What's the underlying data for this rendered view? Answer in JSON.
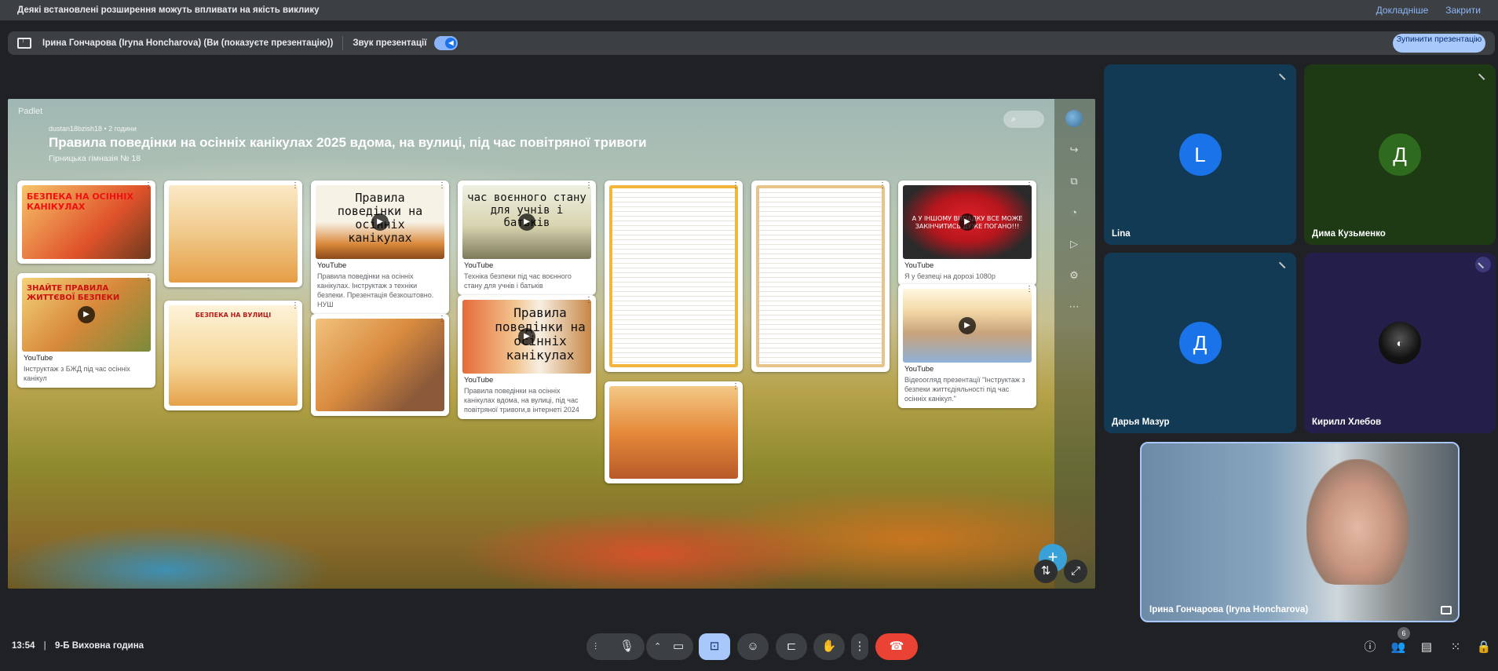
{
  "notification": {
    "message": "Деякі встановлені розширення можуть впливати на якість виклику",
    "details_link": "Докладніше",
    "close_link": "Закрити"
  },
  "presenting_bar": {
    "presenter": "Ірина Гончарова (Iryna Honcharova) (Ви (показуєте презентацію))",
    "audio_label": "Звук презентації",
    "stop_button": "Зупинити презентацію"
  },
  "padlet": {
    "brand": "Padlet",
    "author": "dustan18bzish18 • 2 години",
    "title": "Правила поведінки на осінніх канікулах 2025 вдома, на вулиці, під час повітряної тривоги",
    "subtitle": "Гірницька гімназія № 18",
    "cards": [
      {
        "thumb_text": "БЕЗПЕКА НА ОСІННІХ КАНІКУЛАХ",
        "source": "",
        "caption": ""
      },
      {
        "thumb_text": "ЗНАЙТЕ ПРАВИЛА ЖИТТЄВОЇ БЕЗПЕКИ",
        "source": "YouTube",
        "caption": "Інструктаж з БЖД під час осінніх канікул"
      },
      {
        "thumb_text": "",
        "source": "",
        "caption": ""
      },
      {
        "thumb_text": "БЕЗПЕКА НА ВУЛИЦІ",
        "source": "",
        "caption": ""
      },
      {
        "thumb_text": "Правила поведінки на осінніх канікулах",
        "source": "YouTube",
        "caption": "Правила поведінки на осінніх канікулах. Інструктаж з техніки безпеки. Презентація безкоштовно. НУШ"
      },
      {
        "thumb_text": "",
        "source": "",
        "caption": ""
      },
      {
        "thumb_text": "час воєнного стану для учнів і батьків",
        "source": "YouTube",
        "caption": "Техніка безпеки під час воєнного стану для учнів і батьків"
      },
      {
        "thumb_text": "Правила поведінки на осінніх канікулах",
        "source": "YouTube",
        "caption": "Правила поведінки на осінніх канікулах вдома, на вулиці, під час повітряної тривоги,в інтернеті 2024"
      },
      {
        "thumb_text": "",
        "source": "",
        "caption": ""
      },
      {
        "thumb_text": "",
        "source": "",
        "caption": ""
      },
      {
        "thumb_text": "",
        "source": "",
        "caption": ""
      },
      {
        "thumb_text": "А У ІНШОМУ ВИПАДКУ ВСЕ МОЖЕ ЗАКІНЧИТИСЬ ДУЖЕ ПОГАНО!!!",
        "source": "YouTube",
        "caption": "Я у безпеці на дорозі 1080р"
      },
      {
        "thumb_text": "",
        "source": "YouTube",
        "caption": "Відеоогляд презентації \"Інструктаж з безпеки життєдіяльності під час осінніх канікул.\""
      }
    ]
  },
  "participants": [
    {
      "name": "Lina",
      "initial": "L",
      "color": "#1a73e8",
      "bg": "#123a54"
    },
    {
      "name": "Дима Кузьменко",
      "initial": "Д",
      "color": "#2e6b1e",
      "bg": "#1e3a14"
    },
    {
      "name": "Дарья Мазур",
      "initial": "Д",
      "color": "#1a73e8",
      "bg": "#123a54"
    },
    {
      "name": "Кирилл Хлебов",
      "initial": "",
      "color": "#222",
      "bg": "#231f4a"
    },
    {
      "name": "Ірина Гончарова (Iryna Honcharova)",
      "initial": "",
      "color": "",
      "bg": "#5d7f9c"
    }
  ],
  "bottom": {
    "time": "13:54",
    "meeting": "9-Б Виховна година",
    "participant_count": "6"
  },
  "icons": {
    "mic": "mic-icon",
    "camera": "camera-icon",
    "present": "present-icon",
    "emoji": "emoji-icon",
    "captions": "captions-icon",
    "hand": "raise-hand-icon",
    "more": "more-icon",
    "end_call": "end-call-icon"
  }
}
